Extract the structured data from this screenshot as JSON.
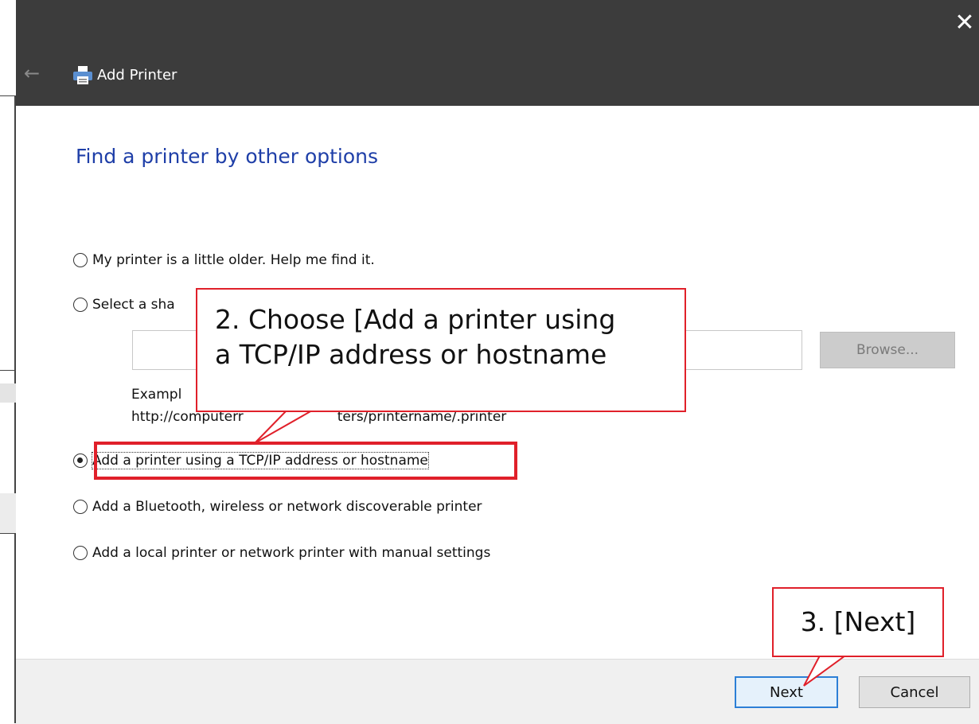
{
  "window": {
    "title": "Add Printer",
    "close_glyph": "✕",
    "back_glyph": "←",
    "icons": {
      "title": "printer-icon",
      "back": "back-arrow-icon",
      "close": "close-icon"
    }
  },
  "page": {
    "heading": "Find a printer by other options"
  },
  "options": [
    {
      "label": "My printer is a little older. Help me find it.",
      "checked": false
    },
    {
      "label": "Select a sha",
      "checked": false
    },
    {
      "label": "Add a printer using a TCP/IP address or hostname",
      "checked": true
    },
    {
      "label": "Add a Bluetooth, wireless or network discoverable printer",
      "checked": false
    },
    {
      "label": "Add a local printer or network printer with manual settings",
      "checked": false
    }
  ],
  "shared_printer": {
    "input_value": "",
    "browse_label": "Browse...",
    "example_line1": "Exampl",
    "example_line2": "http://computerr",
    "example_line2_tail": "ters/printername/.printer"
  },
  "buttons": {
    "next_label": "Next",
    "cancel_label": "Cancel"
  },
  "annotations": {
    "step2_line1": "2. Choose [Add a printer using",
    "step2_line2": "a TCP/IP address or hostname",
    "step3": "3. [Next]",
    "color": "#e0202a"
  },
  "colors": {
    "titlebar": "#3c3c3c",
    "heading": "#1f3fa8",
    "footer": "#f0f0f0",
    "next_border": "#2c7fd6"
  }
}
